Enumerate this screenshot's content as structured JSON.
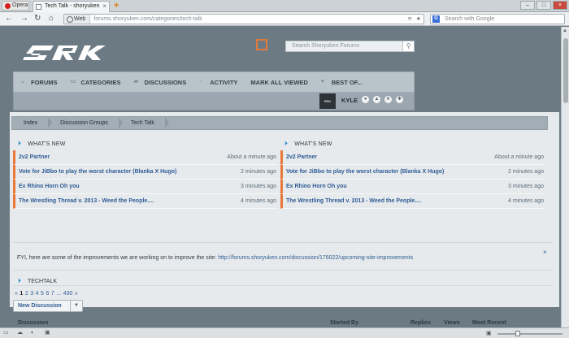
{
  "browser": {
    "opera_label": "Opera",
    "tab_title": "Tech Talk - shoryuken",
    "new_tab": "+",
    "address_badge": "Web",
    "url": "forums.shoryuken.com/categories/tech-talk",
    "search_placeholder": "Search with Google",
    "search_engine": "G"
  },
  "site": {
    "search_placeholder": "Search Shoryuken Forums",
    "nav": [
      "FORUMS",
      "CATEGORIES",
      "DISCUSSIONS",
      "ACTIVITY",
      "MARK ALL VIEWED",
      "BEST OF..."
    ],
    "username": "KYLE"
  },
  "breadcrumbs": [
    "Index",
    "Discussion Groups",
    "Tech Talk"
  ],
  "whats_new": {
    "heading": "WHAT'S NEW",
    "items": [
      {
        "title": "2v2 Partner",
        "time": "About a minute ago"
      },
      {
        "title": "Vote for JiBbo to play the worst character (Blanka X Hugo)",
        "time": "2 minutes ago"
      },
      {
        "title": "Ex Rhino Horn Oh you",
        "time": "3 minutes ago"
      },
      {
        "title": "The Wrestling Thread v. 2013 - Weed the People....",
        "time": "4 minutes ago"
      }
    ]
  },
  "fyi": {
    "text": "FYI, here are some of the improvements we are working on to improve the site:",
    "link": "http://forums.shoryuken.com/discussion/176022/upcoming-site-improvements",
    "close": "×"
  },
  "techtalk": {
    "heading": "TECHTALK",
    "pager": [
      "«",
      "1",
      "2",
      "3",
      "4",
      "5",
      "6",
      "7",
      "...",
      "430",
      "»"
    ],
    "current_page": "1",
    "new_discussion": "New Discussion",
    "columns": [
      "Discussion",
      "Started By",
      "Replies",
      "Views",
      "Most Recent"
    ]
  },
  "colors": {
    "accent_orange": "#e8773a",
    "link_blue": "#2e5d96",
    "page_bg": "#6c7a84"
  }
}
